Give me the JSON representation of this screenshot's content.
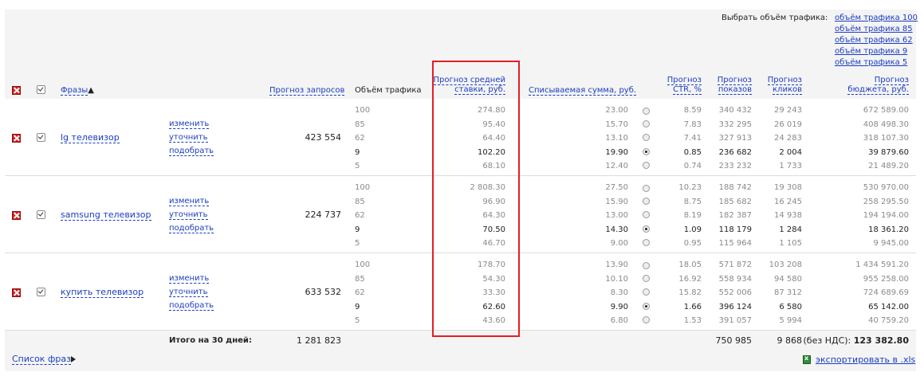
{
  "traffic_selector": {
    "label": "Выбрать объём трафика:",
    "options": [
      "объём трафика 100",
      "объём трафика 85",
      "объём трафика 62",
      "объём трафика 9",
      "объём трафика 5"
    ]
  },
  "headers": {
    "phrases": "Фразы",
    "sort_mark": "▲",
    "requests_forecast": "Прогноз запросов",
    "traffic_volume": "Объём трафика",
    "avg_bid_line1": "Прогноз средней",
    "avg_bid_line2": "ставки, руб.",
    "charged_sum": "Списываемая сумма, руб.",
    "ctr_line1": "Прогноз",
    "ctr_line2": "CTR, %",
    "shows_line1": "Прогноз",
    "shows_line2": "показов",
    "clicks_line1": "Прогноз",
    "clicks_line2": "кликов",
    "budget_line1": "Прогноз",
    "budget_line2": "бюджета, руб."
  },
  "action_links": {
    "change": "изменить",
    "refine": "уточнить",
    "pick": "подобрать"
  },
  "phrases": [
    {
      "name": "lg телевизор",
      "requests": "423 554",
      "rows": [
        {
          "vol": "100",
          "bid": "274.80",
          "sum": "23.00",
          "ctr": "8.59",
          "shows": "340 432",
          "clicks": "29 243",
          "budget": "672 589.00"
        },
        {
          "vol": "85",
          "bid": "95.40",
          "sum": "15.70",
          "ctr": "7.83",
          "shows": "332 295",
          "clicks": "26 019",
          "budget": "408 498.30"
        },
        {
          "vol": "62",
          "bid": "64.40",
          "sum": "13.10",
          "ctr": "7.41",
          "shows": "327 913",
          "clicks": "24 283",
          "budget": "318 107.30"
        },
        {
          "vol": "9",
          "bid": "102.20",
          "sum": "19.90",
          "ctr": "0.85",
          "shows": "236 682",
          "clicks": "2 004",
          "budget": "39 879.60"
        },
        {
          "vol": "5",
          "bid": "68.10",
          "sum": "12.40",
          "ctr": "0.74",
          "shows": "233 232",
          "clicks": "1 733",
          "budget": "21 489.20"
        }
      ]
    },
    {
      "name": "samsung телевизор",
      "requests": "224 737",
      "rows": [
        {
          "vol": "100",
          "bid": "2 808.30",
          "sum": "27.50",
          "ctr": "10.23",
          "shows": "188 742",
          "clicks": "19 308",
          "budget": "530 970.00"
        },
        {
          "vol": "85",
          "bid": "96.90",
          "sum": "15.90",
          "ctr": "8.75",
          "shows": "185 682",
          "clicks": "16 245",
          "budget": "258 295.50"
        },
        {
          "vol": "62",
          "bid": "64.30",
          "sum": "13.00",
          "ctr": "8.19",
          "shows": "182 387",
          "clicks": "14 938",
          "budget": "194 194.00"
        },
        {
          "vol": "9",
          "bid": "70.50",
          "sum": "14.30",
          "ctr": "1.09",
          "shows": "118 179",
          "clicks": "1 284",
          "budget": "18 361.20"
        },
        {
          "vol": "5",
          "bid": "46.70",
          "sum": "9.00",
          "ctr": "0.95",
          "shows": "115 964",
          "clicks": "1 105",
          "budget": "9 945.00"
        }
      ]
    },
    {
      "name": "купить телевизор",
      "requests": "633 532",
      "rows": [
        {
          "vol": "100",
          "bid": "178.70",
          "sum": "13.90",
          "ctr": "18.05",
          "shows": "571 872",
          "clicks": "103 208",
          "budget": "1 434 591.20"
        },
        {
          "vol": "85",
          "bid": "54.30",
          "sum": "10.10",
          "ctr": "16.92",
          "shows": "558 934",
          "clicks": "94 580",
          "budget": "955 258.00"
        },
        {
          "vol": "62",
          "bid": "33.30",
          "sum": "8.30",
          "ctr": "15.82",
          "shows": "552 006",
          "clicks": "87 312",
          "budget": "724 689.69"
        },
        {
          "vol": "9",
          "bid": "62.60",
          "sum": "9.90",
          "ctr": "1.66",
          "shows": "396 124",
          "clicks": "6 580",
          "budget": "65 142.00"
        },
        {
          "vol": "5",
          "bid": "43.60",
          "sum": "6.80",
          "ctr": "1.53",
          "shows": "391 057",
          "clicks": "5 994",
          "budget": "40 759.20"
        }
      ]
    }
  ],
  "totals": {
    "label": "Итого на 30 дней:",
    "requests": "1 281 823",
    "shows": "750 985",
    "clicks": "9 868",
    "budget_prefix": "(без НДС):",
    "budget": "123 382.80"
  },
  "footer": {
    "phrase_list": "Список фраз",
    "export": "экспортировать в .xls"
  }
}
